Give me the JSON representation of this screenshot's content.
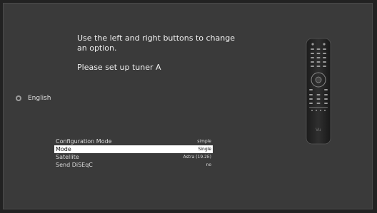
{
  "instructions": {
    "line1": "Use the left and right buttons to change an option.",
    "line2": "Please set up tuner A"
  },
  "language": {
    "label": "English"
  },
  "config_rows": [
    {
      "label": "Configuration Mode",
      "value": "simple",
      "selected": false
    },
    {
      "label": "Mode",
      "value": "Single",
      "selected": true
    },
    {
      "label": "Satellite",
      "value": "Astra (19.2E)",
      "selected": false
    },
    {
      "label": "Send DiSEqC",
      "value": "no",
      "selected": false
    }
  ],
  "remote": {
    "logo": "Vu"
  },
  "colors": {
    "background": "#3a3a3a",
    "selected_row": "#ffffff"
  }
}
